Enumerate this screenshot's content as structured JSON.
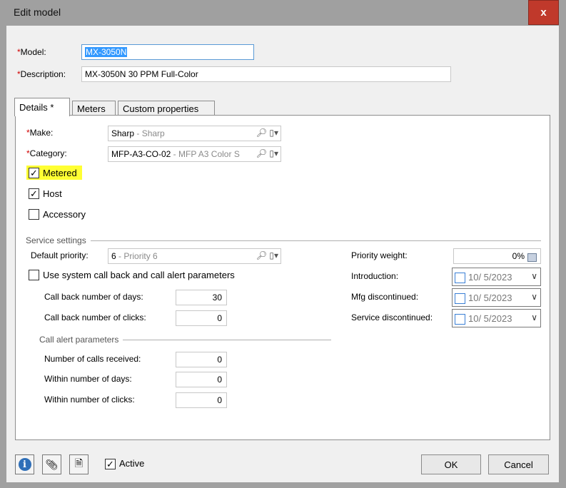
{
  "window": {
    "title": "Edit model",
    "close_label": "x"
  },
  "header": {
    "model_label": "Model:",
    "model_value": "MX-3050N",
    "description_label": "Description:",
    "description_value": "MX-3050N 30 PPM Full-Color",
    "required_mark": "*"
  },
  "tabs": [
    {
      "label": "Details *",
      "active": true
    },
    {
      "label": "Meters",
      "active": false
    },
    {
      "label": "Custom properties",
      "active": false
    }
  ],
  "details": {
    "make_label": "Make:",
    "make_value": "Sharp",
    "make_desc": " - Sharp",
    "category_label": "Category:",
    "category_value": "MFP-A3-CO-02",
    "category_desc": " - MFP A3 Color S",
    "metered_label": "Metered",
    "metered_checked": true,
    "host_label": "Host",
    "host_checked": true,
    "accessory_label": "Accessory",
    "accessory_checked": false
  },
  "service": {
    "group_title": "Service settings",
    "default_priority_label": "Default priority:",
    "default_priority_value": "6",
    "default_priority_desc": " - Priority 6",
    "use_system_label": "Use system call back and call alert parameters",
    "use_system_checked": false,
    "callback_days_label": "Call back number of days:",
    "callback_days_value": "30",
    "callback_clicks_label": "Call back number of clicks:",
    "callback_clicks_value": "0",
    "call_alert_title": "Call alert parameters",
    "calls_received_label": "Number of calls received:",
    "calls_received_value": "0",
    "within_days_label": "Within number of days:",
    "within_days_value": "0",
    "within_clicks_label": "Within number of clicks:",
    "within_clicks_value": "0",
    "priority_weight_label": "Priority weight:",
    "priority_weight_value": "0%",
    "introduction_label": "Introduction:",
    "introduction_value": "10/  5/2023",
    "mfg_discontinued_label": "Mfg discontinued:",
    "mfg_discontinued_value": "10/  5/2023",
    "service_discontinued_label": "Service discontinued:",
    "service_discontinued_value": "10/  5/2023"
  },
  "footer": {
    "active_label": "Active",
    "active_checked": true,
    "ok_label": "OK",
    "cancel_label": "Cancel"
  },
  "icons": {
    "search": "magnifier",
    "lookup_menu": "lookup-dropdown",
    "calendar": "calendar",
    "info": "info",
    "attachment": "paperclip",
    "notes": "document"
  },
  "colors": {
    "required": "#d00000",
    "highlight": "#ffff33",
    "selection": "#3399ff",
    "close_button": "#c0392b"
  }
}
